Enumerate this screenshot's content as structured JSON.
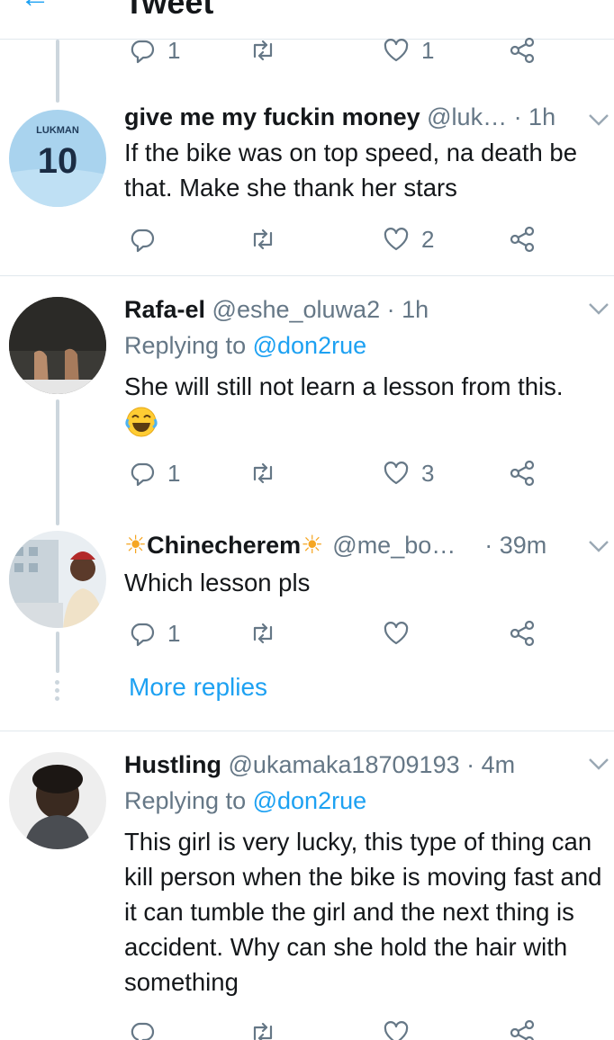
{
  "header": {
    "back_icon": "back-arrow-icon",
    "title": "Tweet"
  },
  "colors": {
    "accent": "#1da1f2",
    "muted": "#657786",
    "divider": "#e1e8ed"
  },
  "top_actions": {
    "replies": "1",
    "retweets": "",
    "likes": "1"
  },
  "tweets": [
    {
      "name": "give me my fuckin money",
      "meta": "@luk… · 1h",
      "replying_label": "",
      "replying_handle": "",
      "text": "If the bike was on top speed, na death be that. Make she thank her stars",
      "replies": "",
      "retweets": "",
      "likes": "2",
      "avatar_text_top": "LUKMAN",
      "avatar_text_num": "10"
    },
    {
      "name": "Rafa-el",
      "meta": "@eshe_oluwa2 · 1h",
      "replying_label": "Replying to",
      "replying_handle": "@don2rue",
      "text": "She will still not learn a lesson from this.",
      "emoji": "😂",
      "replies": "1",
      "retweets": "",
      "likes": "3"
    },
    {
      "name_star": "☀",
      "name": "Chinecherem",
      "meta_handle": "@me_bo…",
      "meta_time": "· 39m",
      "text": "Which lesson pls",
      "replies": "1",
      "retweets": "",
      "likes": ""
    },
    {
      "name": "Hustling",
      "meta": "@ukamaka18709193 · 4m",
      "replying_label": "Replying to",
      "replying_handle": "@don2rue",
      "text": "This girl is very lucky, this type of thing can kill person when the bike is moving fast and it can tumble the girl and the next thing is accident. Why can she hold the hair with something",
      "replies": "",
      "retweets": "",
      "likes": ""
    }
  ],
  "more_replies": "More replies"
}
